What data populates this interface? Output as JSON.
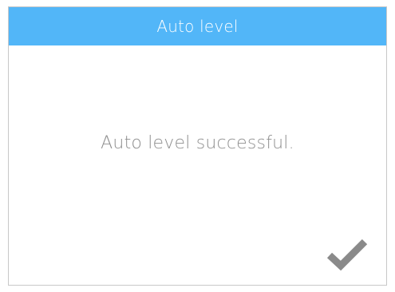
{
  "dialog": {
    "title": "Auto level",
    "message": "Auto level successful.",
    "confirm_icon": "checkmark-icon"
  },
  "colors": {
    "title_bar": "#52b6f8",
    "title_text": "#ffffff",
    "message_text": "#8f8f8f",
    "checkmark": "#8a8a8a",
    "border": "#c8c8c8"
  }
}
